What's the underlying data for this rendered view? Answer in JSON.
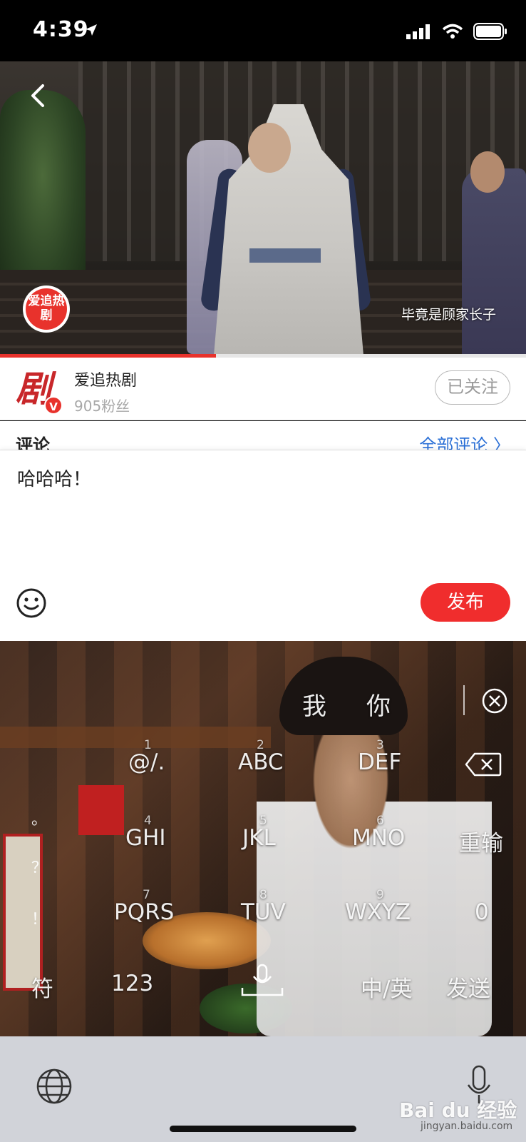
{
  "status_bar": {
    "time": "4:39"
  },
  "video": {
    "channel_logo_text": "爱追热剧",
    "subtitle": "毕竟是顾家长子",
    "progress_fraction": 0.41
  },
  "channel": {
    "avatar_char": "剧",
    "avatar_badge": "V",
    "name": "爱追热剧",
    "fans": "905粉丝",
    "follow_label": "已关注"
  },
  "comments": {
    "title": "评论",
    "all_label": "全部评论 〉"
  },
  "input": {
    "text": "哈哈哈！",
    "publish_label": "发布"
  },
  "keyboard": {
    "candidates": [
      "我",
      "你"
    ],
    "side_chars": [
      "。",
      "？",
      "！"
    ],
    "keys": [
      {
        "num": "1",
        "label": "@/."
      },
      {
        "num": "2",
        "label": "ABC"
      },
      {
        "num": "3",
        "label": "DEF"
      },
      {
        "num": "4",
        "label": "GHI"
      },
      {
        "num": "5",
        "label": "JKL"
      },
      {
        "num": "6",
        "label": "MNO"
      },
      {
        "num": "",
        "label": "重输"
      },
      {
        "num": "7",
        "label": "PQRS"
      },
      {
        "num": "8",
        "label": "TUV"
      },
      {
        "num": "9",
        "label": "WXYZ"
      },
      {
        "num": "",
        "label": "0"
      },
      {
        "num": "",
        "label": "符"
      },
      {
        "num": "",
        "label": "123"
      },
      {
        "num": "",
        "label": "中/英"
      },
      {
        "num": "",
        "label": "发送"
      }
    ]
  },
  "watermark": {
    "brand": "Bai du 经验",
    "url": "jingyan.baidu.com"
  },
  "colors": {
    "accent_red": "#f02d2d",
    "link_blue": "#2a6fd6"
  }
}
